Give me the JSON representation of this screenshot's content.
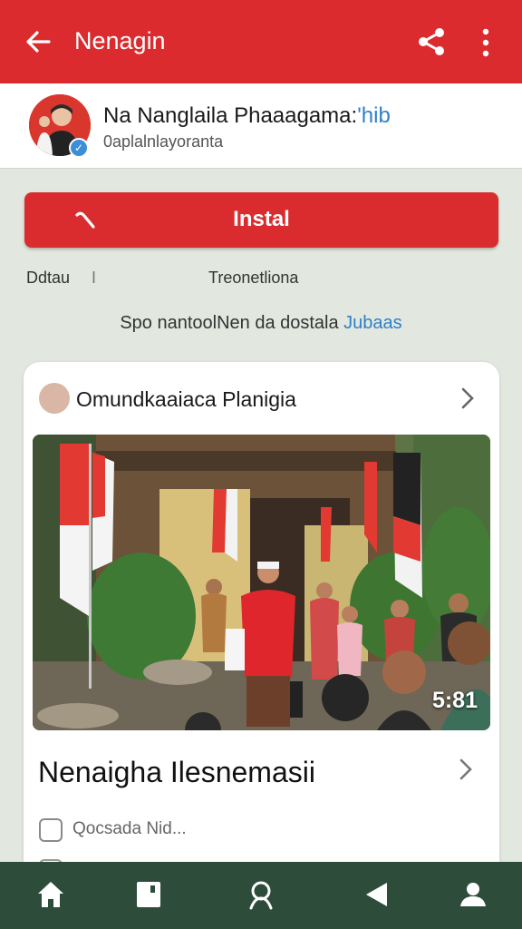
{
  "appbar": {
    "title": "Nenagin",
    "back_icon": "arrow-left-icon",
    "share_icon": "share-icon",
    "more_icon": "more-vertical-icon",
    "color": "#db2b2e"
  },
  "profile": {
    "name": "Na Nanglaila Phaaagama:",
    "name_link": "'hib",
    "subtitle": "0aplalnlayoranta",
    "verified_icon": "verified-check-icon"
  },
  "install": {
    "label": "Instal",
    "icon": "wrench-icon",
    "color": "#da2c2e"
  },
  "meta": {
    "left": "Ddtau",
    "separator": "I",
    "middle": "Treonetliona"
  },
  "info": {
    "text": "Spo nantoolNen da dostala ",
    "link": "Jubaas"
  },
  "card": {
    "header_title": "Omundkaaiaca Planigia",
    "photo_count": "5:81",
    "article_title": "Nenaigha Ilesnemasii",
    "footer_text": "Qocsada Nid..."
  },
  "bottom_nav": {
    "items": [
      "home-icon",
      "bookmark-icon",
      "profile-search-icon",
      "back-triangle-icon",
      "account-icon"
    ],
    "color": "#2d4d3a"
  }
}
